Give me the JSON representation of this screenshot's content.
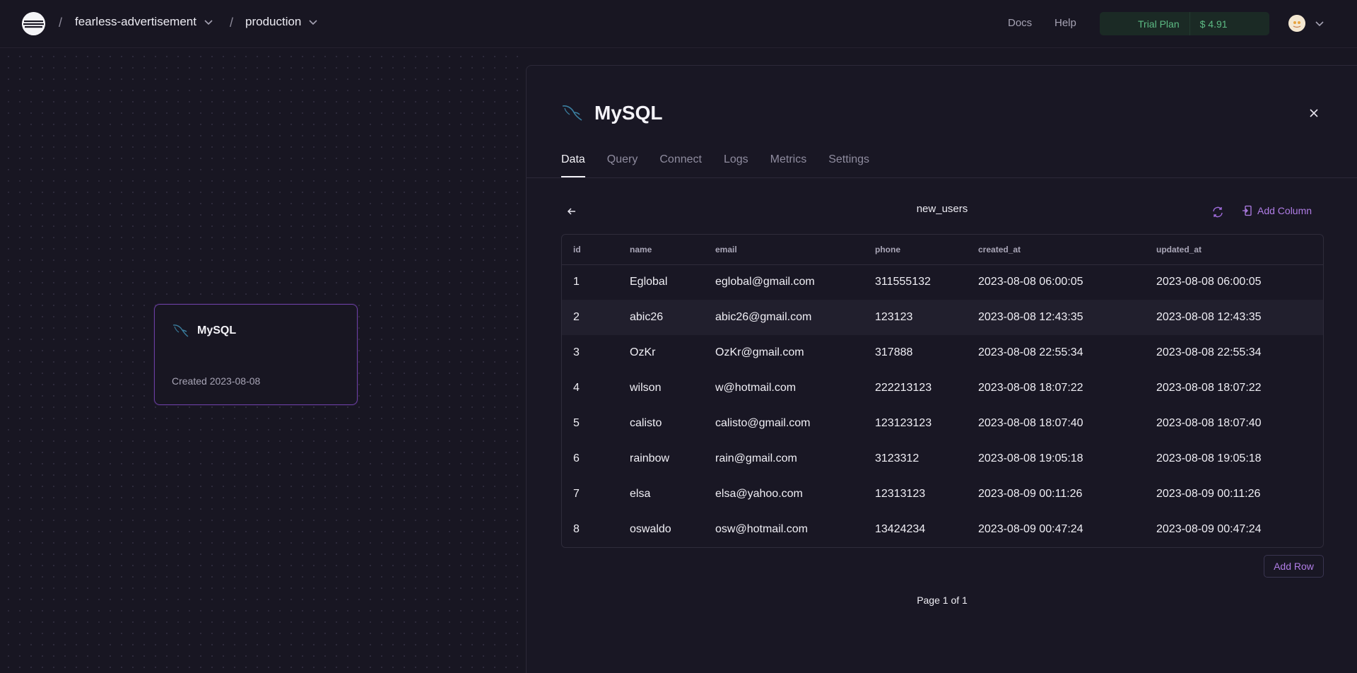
{
  "header": {
    "project": "fearless-advertisement",
    "environment": "production",
    "separator": "/",
    "docs": "Docs",
    "help": "Help",
    "plan_name": "Trial Plan",
    "plan_amount": "$ 4.91"
  },
  "canvas": {
    "node": {
      "title": "MySQL",
      "created": "Created 2023-08-08",
      "icon": "mysql-dolphin-icon"
    }
  },
  "panel": {
    "title": "MySQL",
    "icon": "mysql-dolphin-icon",
    "tabs": [
      {
        "label": "Data",
        "active": true
      },
      {
        "label": "Query"
      },
      {
        "label": "Connect"
      },
      {
        "label": "Logs"
      },
      {
        "label": "Metrics"
      },
      {
        "label": "Settings"
      }
    ],
    "table_name": "new_users",
    "add_column": "Add Column",
    "add_row": "Add Row",
    "pager": "Page 1 of 1",
    "columns": [
      "id",
      "name",
      "email",
      "phone",
      "created_at",
      "updated_at"
    ],
    "rows": [
      [
        "1",
        "Eglobal",
        "eglobal@gmail.com",
        "311555132",
        "2023-08-08 06:00:05",
        "2023-08-08 06:00:05"
      ],
      [
        "2",
        "abic26",
        "abic26@gmail.com",
        "123123",
        "2023-08-08 12:43:35",
        "2023-08-08 12:43:35"
      ],
      [
        "3",
        "OzKr",
        "OzKr@gmail.com",
        "317888",
        "2023-08-08 22:55:34",
        "2023-08-08 22:55:34"
      ],
      [
        "4",
        "wilson",
        "w@hotmail.com",
        "222213123",
        "2023-08-08 18:07:22",
        "2023-08-08 18:07:22"
      ],
      [
        "5",
        "calisto",
        "calisto@gmail.com",
        "123123123",
        "2023-08-08 18:07:40",
        "2023-08-08 18:07:40"
      ],
      [
        "6",
        "rainbow",
        "rain@gmail.com",
        "3123312",
        "2023-08-08 19:05:18",
        "2023-08-08 19:05:18"
      ],
      [
        "7",
        "elsa",
        "elsa@yahoo.com",
        "12313123",
        "2023-08-09 00:11:26",
        "2023-08-09 00:11:26"
      ],
      [
        "8",
        "oswaldo",
        "osw@hotmail.com",
        "13424234",
        "2023-08-09 00:47:24",
        "2023-08-09 00:47:24"
      ]
    ],
    "highlighted_row": 1
  },
  "colors": {
    "accent": "#b07de6",
    "plan_green": "#5dbb84",
    "background": "#181622"
  }
}
